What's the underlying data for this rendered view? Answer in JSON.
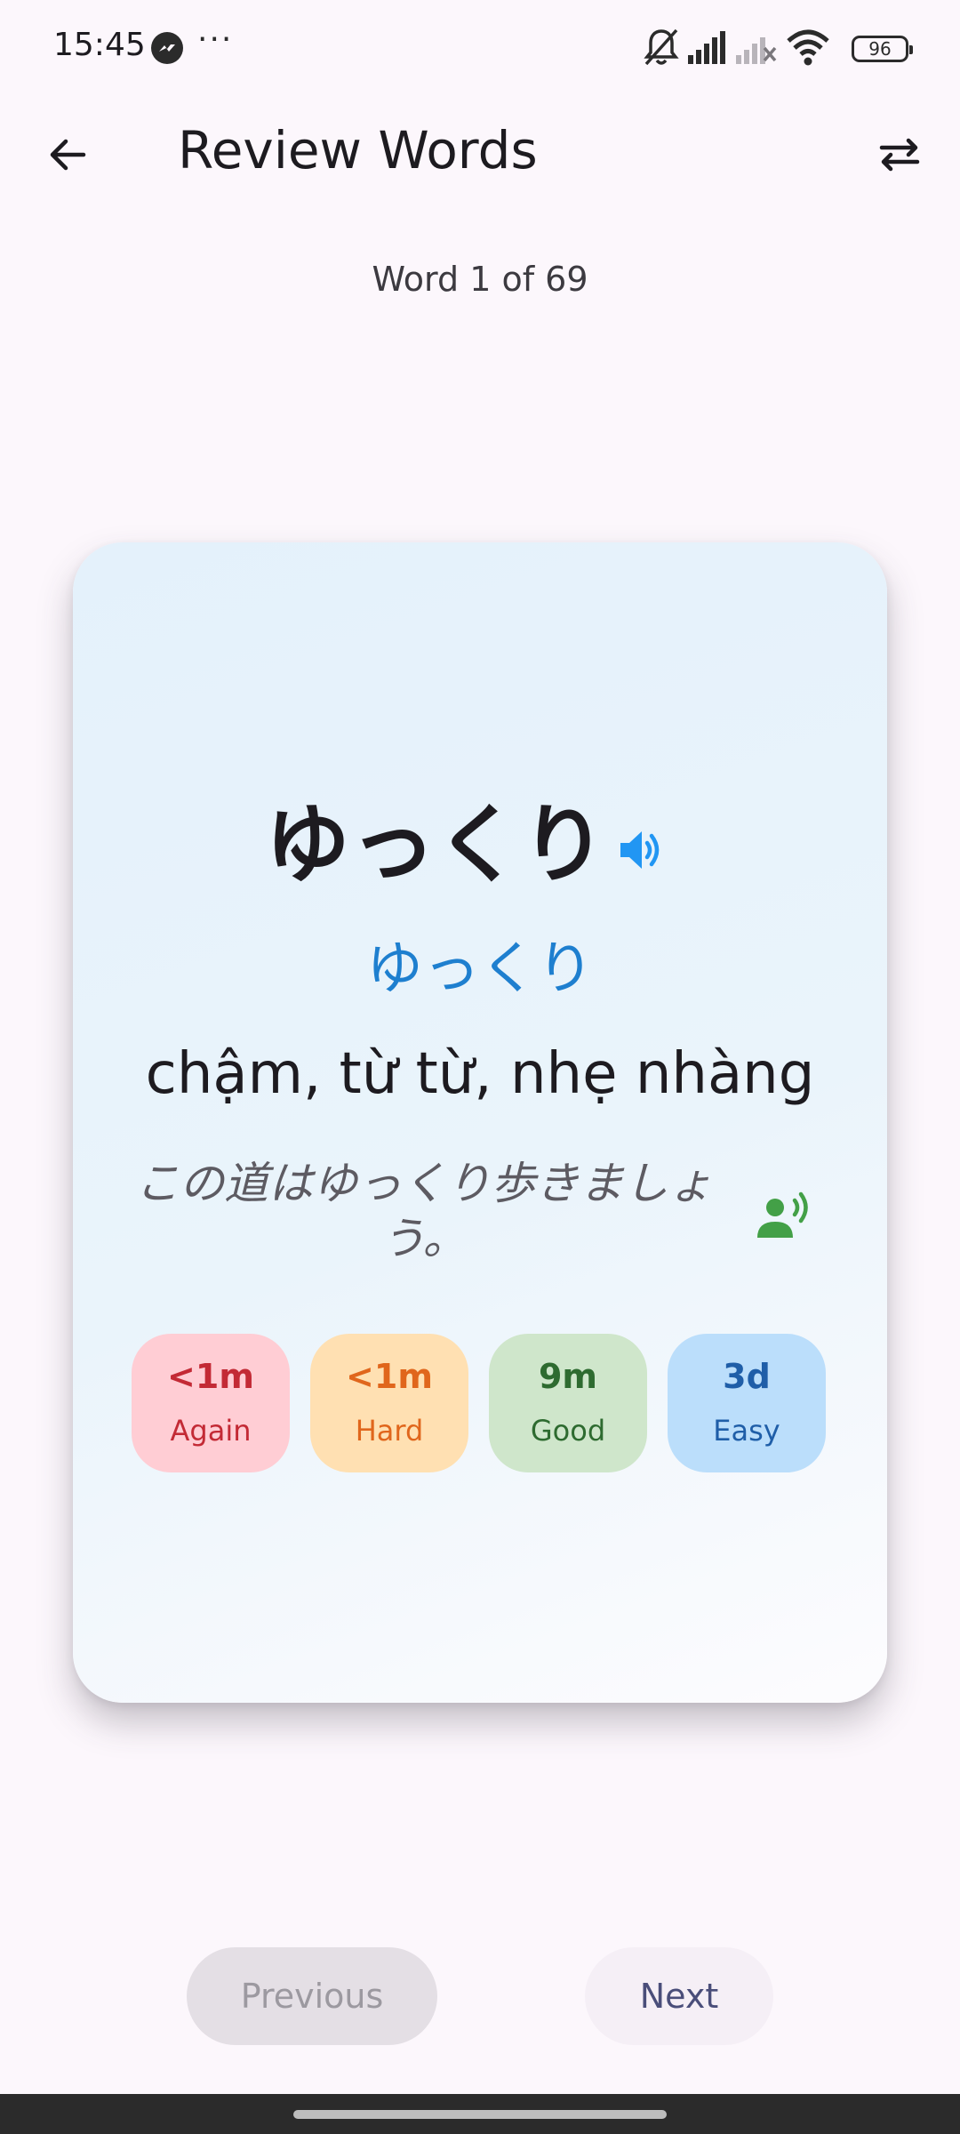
{
  "status_bar": {
    "time": "15:45",
    "battery": "96",
    "icons": [
      "messenger-icon",
      "more-dots-icon",
      "bell-off-icon",
      "signal-icon",
      "signal-off-icon",
      "wifi-icon",
      "battery-icon"
    ]
  },
  "app_bar": {
    "title": "Review Words",
    "back_icon": "arrow-back-icon",
    "swap_icon": "swap-icon"
  },
  "progress": {
    "text": "Word 1 of 69",
    "current": 1,
    "total": 69
  },
  "card": {
    "word": "ゆっくり",
    "reading": "ゆっくり",
    "meaning": "chậm, từ từ, nhẹ nhàng",
    "example": "この道はゆっくり歩きましょう。",
    "colors": {
      "reading": "#1e7fcf",
      "speaker": "#2196f3",
      "example_audio": "#43a047"
    }
  },
  "ratings": [
    {
      "interval": "<1m",
      "label": "Again"
    },
    {
      "interval": "<1m",
      "label": "Hard"
    },
    {
      "interval": "9m",
      "label": "Good"
    },
    {
      "interval": "3d",
      "label": "Easy"
    }
  ],
  "navigation": {
    "previous_label": "Previous",
    "next_label": "Next"
  }
}
